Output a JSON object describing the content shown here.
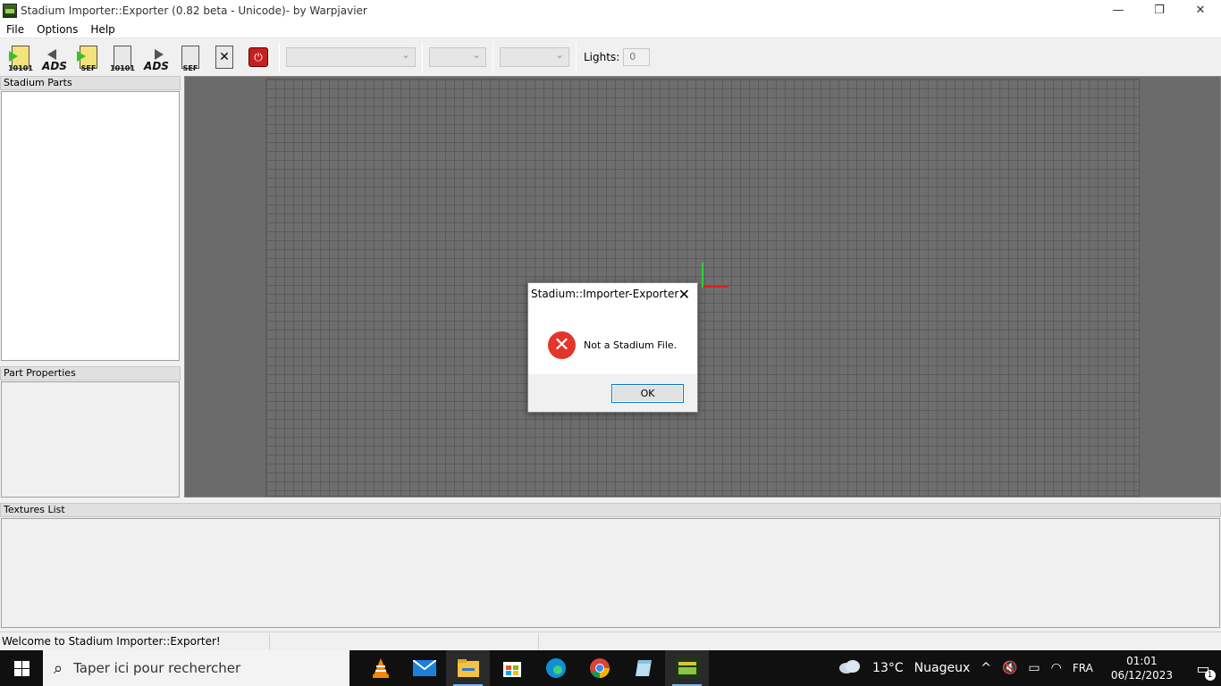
{
  "window": {
    "title": "Stadium Importer::Exporter (0.82 beta - Unicode)- by Warpjavier",
    "minimize_glyph": "—",
    "restore_glyph": "❐",
    "close_glyph": "✕"
  },
  "menubar": {
    "items": [
      "File",
      "Options",
      "Help"
    ]
  },
  "toolbar": {
    "buttons": [
      {
        "icon": "import-binary-icon",
        "label": "10101"
      },
      {
        "icon": "import-ads-icon",
        "label": "ADS"
      },
      {
        "icon": "import-sef-icon",
        "label": "SEF"
      },
      {
        "icon": "export-binary-icon",
        "label": "10101"
      },
      {
        "icon": "export-ads-icon",
        "label": "ADS"
      },
      {
        "icon": "export-sef-icon",
        "label": "SEF"
      },
      {
        "icon": "close-file-icon",
        "label": ""
      },
      {
        "icon": "power-icon",
        "label": ""
      }
    ],
    "power_glyph": "⏻",
    "lights_label": "Lights:",
    "lights_value": "0"
  },
  "panels": {
    "stadium_parts": "Stadium Parts",
    "part_properties": "Part Properties",
    "textures_list": "Textures List"
  },
  "statusbar": {
    "message": "Welcome to Stadium Importer::Exporter!"
  },
  "dialog": {
    "title": "Stadium::Importer-Exporter",
    "message": "Not a Stadium File.",
    "ok_label": "OK",
    "close_glyph": "✕",
    "error_glyph": "✕"
  },
  "taskbar": {
    "search_placeholder": "Taper ici pour rechercher",
    "apps": [
      "vlc-icon",
      "mail-icon",
      "file-explorer-icon",
      "store-icon",
      "edge-icon",
      "chrome-icon",
      "notepad-icon",
      "stadium-app-icon"
    ],
    "weather_temp": "13°C",
    "weather_text": "Nuageux",
    "language": "FRA",
    "time": "01:01",
    "date": "06/12/2023",
    "notification_count": "1"
  }
}
